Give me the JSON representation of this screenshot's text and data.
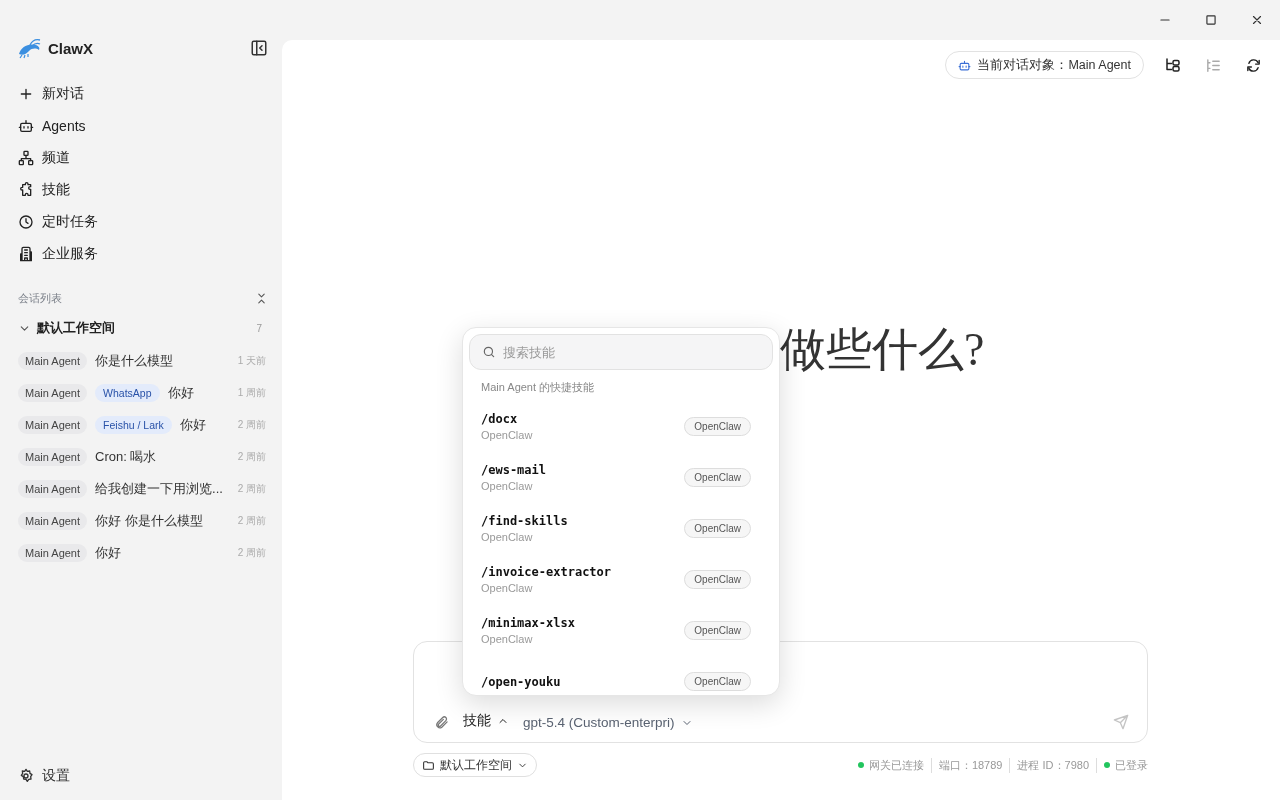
{
  "sidebar": {
    "app_name": "ClawX",
    "nav": [
      {
        "kind": "new",
        "label": "新对话",
        "selected": false
      },
      {
        "kind": "agents",
        "label": "Agents",
        "selected": false
      },
      {
        "kind": "channels",
        "label": "频道",
        "selected": false
      },
      {
        "kind": "skills",
        "label": "技能",
        "selected": false
      },
      {
        "kind": "cron",
        "label": "定时任务",
        "selected": false
      },
      {
        "kind": "enterprise",
        "label": "企业服务",
        "selected": false
      }
    ],
    "section_label": "会话列表",
    "workspace": {
      "name": "默认工作空间",
      "count": "7",
      "expanded": true
    },
    "sessions": [
      {
        "agent": "Main Agent",
        "title": "你是什么模型",
        "time": "1 天前",
        "selected": false
      },
      {
        "agent": "Main Agent",
        "channel": "WhatsApp",
        "title": "你好",
        "time": "1 周前",
        "selected": false
      },
      {
        "agent": "Main Agent",
        "channel": "Feishu / Lark",
        "title": "你好",
        "time": "2 周前",
        "selected": false
      },
      {
        "agent": "Main Agent",
        "title": "Cron: 喝水",
        "time": "2 周前",
        "selected": false
      },
      {
        "agent": "Main Agent",
        "title": "给我创建一下用浏览...",
        "time": "2 周前",
        "selected": false
      },
      {
        "agent": "Main Agent",
        "title": "你好 你是什么模型",
        "time": "2 周前",
        "selected": false
      },
      {
        "agent": "Main Agent",
        "title": "你好",
        "time": "2 周前",
        "selected": false
      }
    ],
    "settings": "设置"
  },
  "header": {
    "target_chip": "当前对话对象：Main Agent"
  },
  "heading": "做些什么?",
  "composer": {
    "skill_button": "技能",
    "skill_expanded": true,
    "model": "gpt-5.4 (Custom-enterpri)",
    "send_disabled": true
  },
  "skill_popup": {
    "placeholder": "搜索技能",
    "subheading": "Main Agent 的快捷技能",
    "items": [
      {
        "command": "/docx",
        "source": "OpenClaw",
        "badge": "OpenClaw"
      },
      {
        "command": "/ews-mail",
        "source": "OpenClaw",
        "badge": "OpenClaw"
      },
      {
        "command": "/find-skills",
        "source": "OpenClaw",
        "badge": "OpenClaw"
      },
      {
        "command": "/invoice-extractor",
        "source": "OpenClaw",
        "badge": "OpenClaw"
      },
      {
        "command": "/minimax-xlsx",
        "source": "OpenClaw",
        "badge": "OpenClaw"
      },
      {
        "command": "/open-youku",
        "badge": "OpenClaw"
      }
    ]
  },
  "footer": {
    "workspace": "默认工作空间",
    "status": [
      {
        "text": "网关已连接",
        "color": "#22c55e"
      },
      {
        "text": "端口：18789"
      },
      {
        "text": "进程 ID：7980"
      },
      {
        "text": "已登录",
        "color": "#22c55e"
      }
    ]
  }
}
